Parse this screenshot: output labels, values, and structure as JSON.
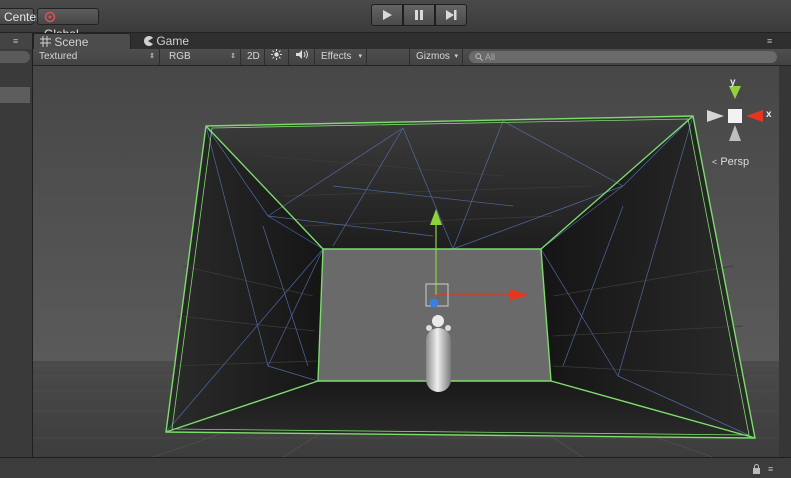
{
  "topbar": {
    "pivot_label": "Center",
    "rotation_label": "Global",
    "play": {
      "play_glyph": "▶",
      "pause_glyph": "❚❚",
      "step_glyph": "▶❙"
    }
  },
  "tabs": [
    {
      "label": "Scene",
      "icon": "grid-icon"
    },
    {
      "label": "Game",
      "icon": "pacman-icon"
    }
  ],
  "toolbar": {
    "shading_mode": "Textured",
    "render_mode": "RGB",
    "mode_2d": "2D",
    "effects": "Effects",
    "gizmos": "Gizmos",
    "search_placeholder": "All"
  },
  "gizmo": {
    "x_label": "x",
    "y_label": "y",
    "projection": "Persp",
    "x_color": "#e8351f",
    "y_color": "#8fd13c"
  },
  "scene": {
    "selection_wire_color": "#7ddc6c",
    "mesh_wire_color": "#5a74b8"
  }
}
